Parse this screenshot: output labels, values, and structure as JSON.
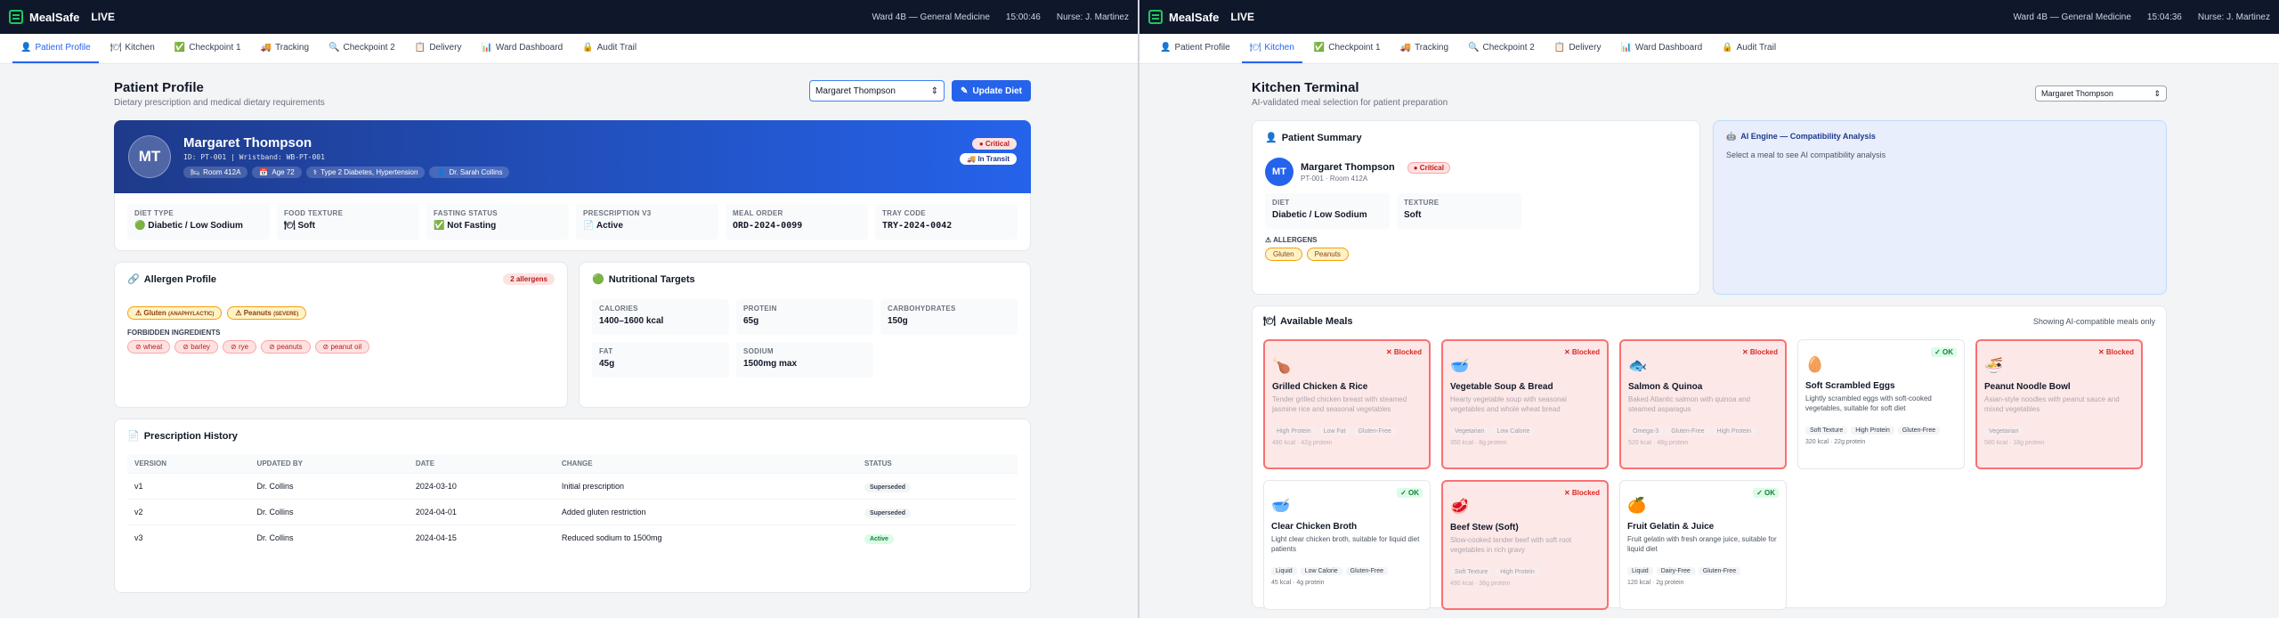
{
  "app": {
    "name": "MealSafe",
    "live": "LIVE"
  },
  "screen1": {
    "ward": "Ward 4B — General Medicine",
    "time": "15:00:46",
    "nurse": "Nurse: J. Martinez",
    "title": "Patient Profile",
    "subtitle": "Dietary prescription and medical dietary requirements",
    "select_value": "Margaret Thompson",
    "update_btn": "Update Diet",
    "patient": {
      "initials": "MT",
      "name": "Margaret Thompson",
      "ids": "ID: PT-001  |  Wristband: WB-PT-001",
      "room": "Room 412A",
      "age": "Age 72",
      "conditions": "Type 2 Diabetes, Hypertension",
      "doctor": "Dr. Sarah Collins",
      "critical": "Critical",
      "transit": "In Transit"
    },
    "diet_cells": [
      {
        "label": "DIET TYPE",
        "value": "Diabetic / Low Sodium"
      },
      {
        "label": "FOOD TEXTURE",
        "value": "Soft"
      },
      {
        "label": "FASTING STATUS",
        "value": "Not Fasting"
      },
      {
        "label": "PRESCRIPTION V3",
        "value": "Active"
      },
      {
        "label": "MEAL ORDER",
        "value": "ORD-2024-0099"
      },
      {
        "label": "TRAY CODE",
        "value": "TRY-2024-0042"
      }
    ],
    "allergen": {
      "title": "Allergen Profile",
      "count": "2 allergens",
      "items": [
        {
          "name": "Gluten",
          "sev": "(ANAPHYLACTIC)"
        },
        {
          "name": "Peanuts",
          "sev": "(SEVERE)"
        }
      ],
      "forbidden_label": "FORBIDDEN INGREDIENTS",
      "forbidden": [
        "wheat",
        "barley",
        "rye",
        "peanuts",
        "peanut oil"
      ]
    },
    "nutrition": {
      "title": "Nutritional Targets",
      "items": [
        {
          "label": "CALORIES",
          "value": "1400–1600 kcal"
        },
        {
          "label": "PROTEIN",
          "value": "65g"
        },
        {
          "label": "CARBOHYDRATES",
          "value": "150g"
        },
        {
          "label": "FAT",
          "value": "45g"
        },
        {
          "label": "SODIUM",
          "value": "1500mg max"
        }
      ]
    },
    "history": {
      "title": "Prescription History",
      "headers": [
        "VERSION",
        "UPDATED BY",
        "DATE",
        "CHANGE",
        "STATUS"
      ],
      "rows": [
        [
          "v1",
          "Dr. Collins",
          "2024-03-10",
          "Initial prescription",
          "Superseded"
        ],
        [
          "v2",
          "Dr. Collins",
          "2024-04-01",
          "Added gluten restriction",
          "Superseded"
        ],
        [
          "v3",
          "Dr. Collins",
          "2024-04-15",
          "Reduced sodium to 1500mg",
          "Active"
        ]
      ]
    }
  },
  "tabs": [
    {
      "label": "Patient Profile",
      "icon": "👤"
    },
    {
      "label": "Kitchen",
      "icon": "🍽"
    },
    {
      "label": "Checkpoint 1",
      "icon": "✅"
    },
    {
      "label": "Tracking",
      "icon": "🚚"
    },
    {
      "label": "Checkpoint 2",
      "icon": "🔍"
    },
    {
      "label": "Delivery",
      "icon": "📋"
    },
    {
      "label": "Ward Dashboard",
      "icon": "📊"
    },
    {
      "label": "Audit Trail",
      "icon": "🔒"
    }
  ],
  "screen2": {
    "ward": "Ward 4B — General Medicine",
    "time": "15:04:36",
    "nurse": "Nurse: J. Martinez",
    "title": "Kitchen Terminal",
    "subtitle": "AI-validated meal selection for patient preparation",
    "select_value": "Margaret Thompson",
    "summary": {
      "title": "Patient Summary",
      "initials": "MT",
      "name": "Margaret Thompson",
      "ids": "PT-001 · Room 412A",
      "critical": "Critical",
      "diet_label": "DIET",
      "diet_value": "Diabetic / Low Sodium",
      "texture_label": "TEXTURE",
      "texture_value": "Soft",
      "allergens_label": "ALLERGENS",
      "allergens": [
        "Gluten",
        "Peanuts"
      ]
    },
    "ai": {
      "title": "AI Engine — Compatibility Analysis",
      "text": "Select a meal to see AI compatibility analysis"
    },
    "meals_title": "Available Meals",
    "meals_note": "Showing AI-compatible meals only",
    "blocked_label": "Blocked",
    "ok_label": "OK",
    "meals": [
      {
        "name": "Grilled Chicken & Rice",
        "icon": "🍗",
        "desc": "Tender grilled chicken breast with steamed jasmine rice and seasonal vegetables",
        "tags": [
          "High Protein",
          "Low Fat",
          "Gluten-Free"
        ],
        "stat": "480 kcal · 42g protein",
        "blocked": true
      },
      {
        "name": "Vegetable Soup & Bread",
        "icon": "🥣",
        "desc": "Hearty vegetable soup with seasonal vegetables and whole wheat bread",
        "tags": [
          "Vegetarian",
          "Low Calorie"
        ],
        "stat": "350 kcal · 8g protein",
        "blocked": true
      },
      {
        "name": "Salmon & Quinoa",
        "icon": "🐟",
        "desc": "Baked Atlantic salmon with quinoa and steamed asparagus",
        "tags": [
          "Omega-3",
          "Gluten-Free",
          "High Protein"
        ],
        "stat": "520 kcal · 48g protein",
        "blocked": true
      },
      {
        "name": "Soft Scrambled Eggs",
        "icon": "🥚",
        "desc": "Lightly scrambled eggs with soft-cooked vegetables, suitable for soft diet",
        "tags": [
          "Soft Texture",
          "High Protein",
          "Gluten-Free"
        ],
        "stat": "320 kcal · 22g protein",
        "blocked": false
      },
      {
        "name": "Peanut Noodle Bowl",
        "icon": "🍜",
        "desc": "Asian-style noodles with peanut sauce and mixed vegetables",
        "tags": [
          "Vegetarian"
        ],
        "stat": "580 kcal · 18g protein",
        "blocked": true
      },
      {
        "name": "Clear Chicken Broth",
        "icon": "🥣",
        "desc": "Light clear chicken broth, suitable for liquid diet patients",
        "tags": [
          "Liquid",
          "Low Calorie",
          "Gluten-Free"
        ],
        "stat": "45 kcal · 4g protein",
        "blocked": false
      },
      {
        "name": "Beef Stew (Soft)",
        "icon": "🥩",
        "desc": "Slow-cooked tender beef with soft root vegetables in rich gravy",
        "tags": [
          "Soft Texture",
          "High Protein"
        ],
        "stat": "490 kcal · 38g protein",
        "blocked": true
      },
      {
        "name": "Fruit Gelatin & Juice",
        "icon": "🍊",
        "desc": "Fruit gelatin with fresh orange juice, suitable for liquid diet",
        "tags": [
          "Liquid",
          "Dairy-Free",
          "Gluten-Free"
        ],
        "stat": "120 kcal · 2g protein",
        "blocked": false
      }
    ]
  }
}
